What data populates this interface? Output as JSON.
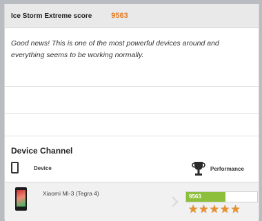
{
  "score": {
    "label": "Ice Storm Extreme score",
    "value": "9563"
  },
  "message": "Good news! This is one of the most powerful devices around and everything seems to be working normally.",
  "channel": {
    "title": "Device Channel",
    "col_device": "Device",
    "col_performance": "Performance",
    "rows": [
      {
        "name": "Xiaomi MI-3 (Tegra 4)",
        "performance_label": "9563",
        "performance_fraction": 0.55,
        "stars": 5
      }
    ]
  },
  "colors": {
    "score_value": "#e37a24",
    "performance_fill": "#8dbf3d",
    "star": "#e8912c"
  },
  "icons": [
    "phone-icon",
    "trophy-icon",
    "chevron-right-icon",
    "star-icon"
  ]
}
